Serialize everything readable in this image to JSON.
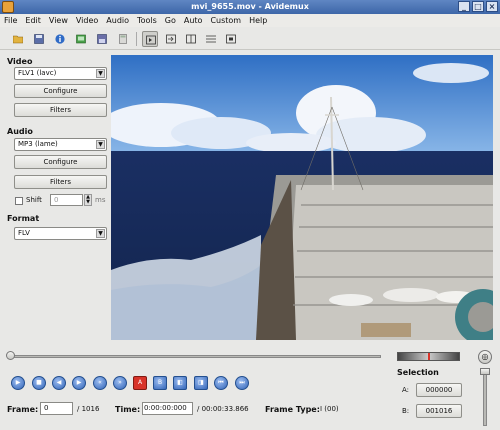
{
  "window": {
    "title": "mvi_9655.mov - Avidemux"
  },
  "menu": [
    "File",
    "Edit",
    "View",
    "Video",
    "Audio",
    "Tools",
    "Go",
    "Auto",
    "Custom",
    "Help"
  ],
  "toolbar": {
    "icons": [
      "open-icon",
      "save-icon",
      "info-icon",
      "save-image-icon",
      "save-video-icon",
      "calculator-icon",
      "input-view-icon",
      "output-view-icon",
      "split-view-icon",
      "horizontal-split-icon",
      "preview-window-icon"
    ]
  },
  "video": {
    "title": "Video",
    "codec": "FLV1 (lavc)",
    "configure": "Configure",
    "filters": "Filters"
  },
  "audio": {
    "title": "Audio",
    "codec": "MP3 (lame)",
    "configure": "Configure",
    "filters": "Filters",
    "shift_label": "Shift",
    "shift_value": "0",
    "shift_unit": "ms"
  },
  "format": {
    "title": "Format",
    "container": "FLV"
  },
  "status": {
    "frame_label": "Frame:",
    "frame_value": "0",
    "frame_total": "/ 1016",
    "time_label": "Time:",
    "time_value": "0:00:00:000",
    "time_total": "/ 00:00:33.866",
    "frame_type_label": "Frame Type:",
    "frame_type_value": "I (00)"
  },
  "selection": {
    "title": "Selection",
    "a_label": "A:",
    "a_value": "000000",
    "b_label": "B:",
    "b_value": "001016"
  },
  "playback": {
    "position": 0.0
  },
  "colors": {
    "titlebar": "#4f77b8",
    "accent": "#3466b8",
    "mark": "#d8342a"
  }
}
